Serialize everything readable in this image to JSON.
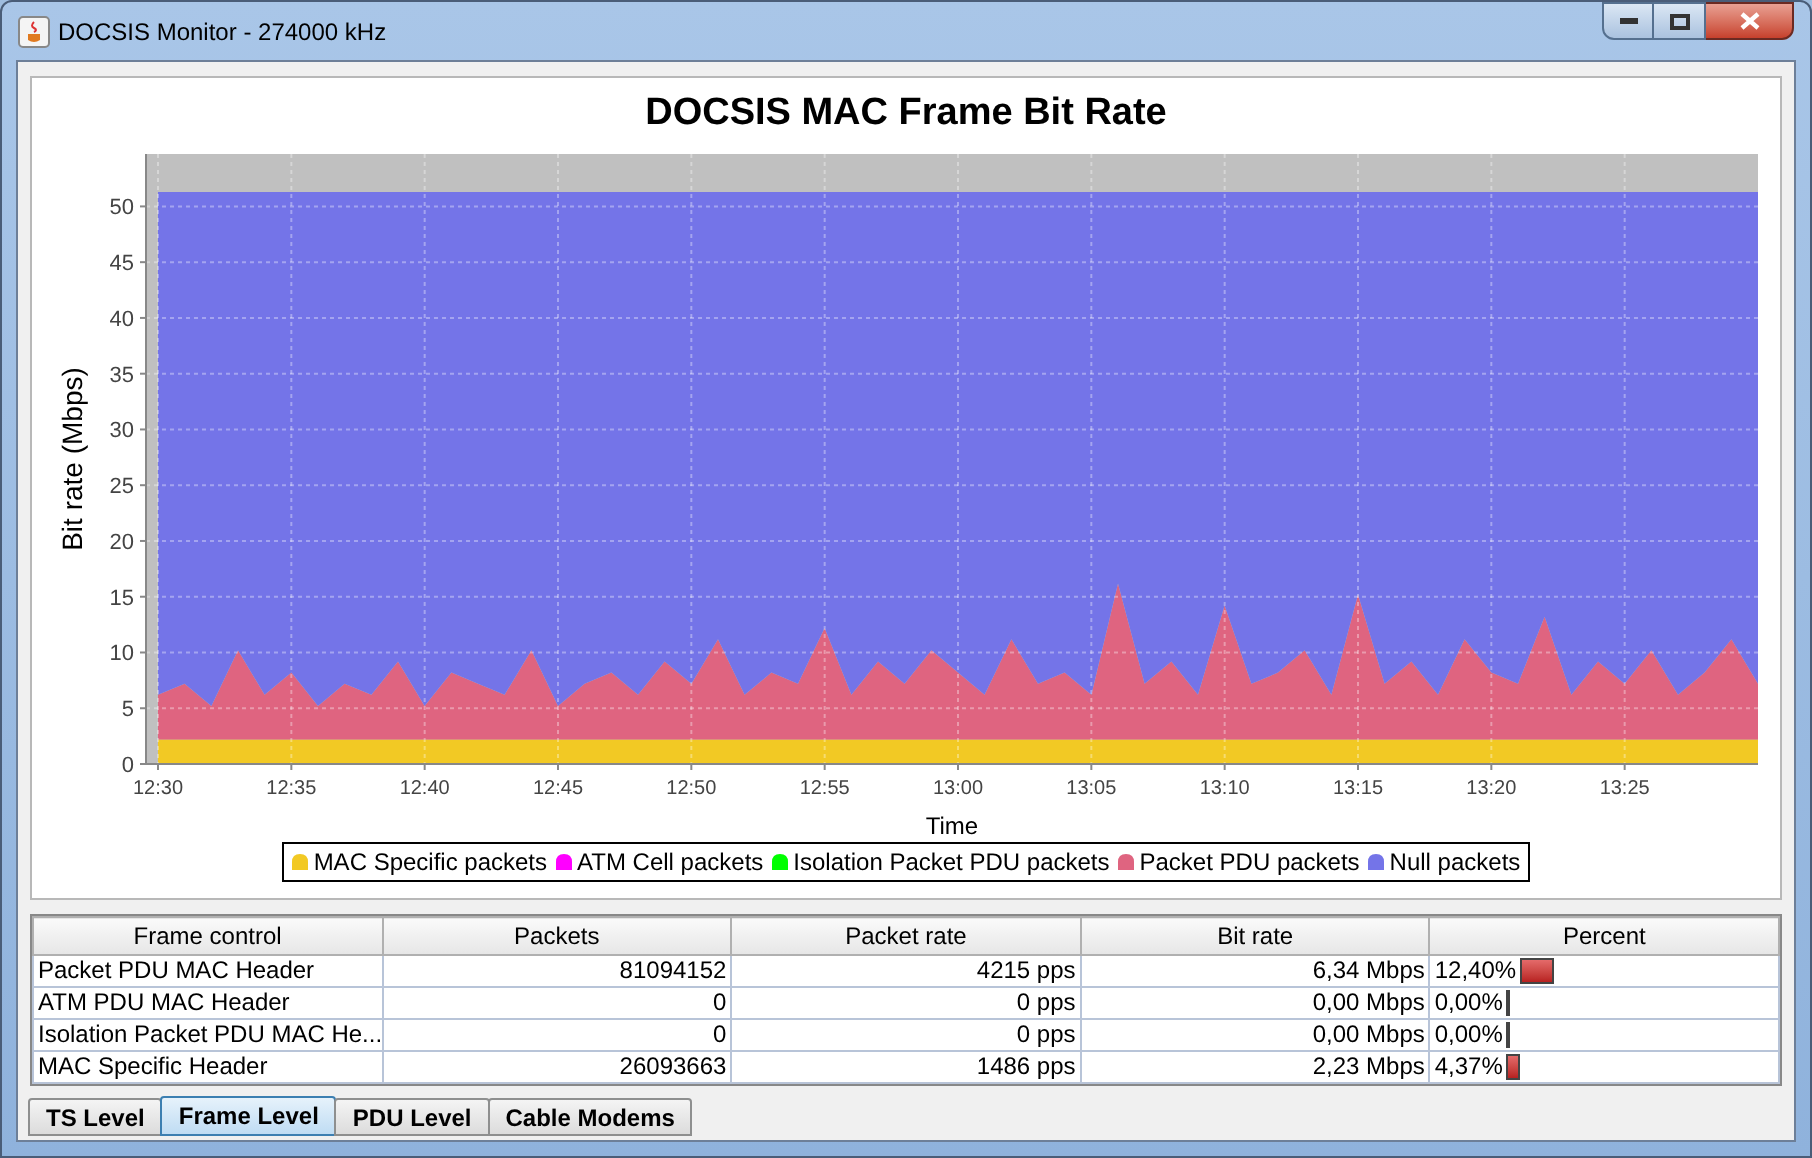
{
  "window": {
    "title": "DOCSIS Monitor - 274000 kHz"
  },
  "chart": {
    "chart_data": {
      "type": "area",
      "stacked": true,
      "grid": true,
      "title": "DOCSIS MAC Frame Bit Rate",
      "xlabel": "Time",
      "ylabel": "Bit rate (Mbps)",
      "categories": [
        "12:30",
        null,
        null,
        null,
        null,
        "12:35",
        null,
        null,
        null,
        null,
        "12:40",
        null,
        null,
        null,
        null,
        "12:45",
        null,
        null,
        null,
        null,
        "12:50",
        null,
        null,
        null,
        null,
        "12:55",
        null,
        null,
        null,
        null,
        "13:00",
        null,
        null,
        null,
        null,
        "13:05",
        null,
        null,
        null,
        null,
        "13:10",
        null,
        null,
        null,
        null,
        "13:15",
        null,
        null,
        null,
        null,
        "13:20",
        null,
        null,
        null,
        null,
        "13:25",
        null,
        null,
        null,
        null,
        null
      ],
      "ylim": [
        0,
        54.7
      ],
      "yticks": [
        0,
        5,
        10,
        15,
        20,
        25,
        30,
        35,
        40,
        45,
        50
      ],
      "series": [
        {
          "color": "#f2c924",
          "values": [
            2.2,
            2.2,
            2.2,
            2.2,
            2.2,
            2.2,
            2.2,
            2.2,
            2.2,
            2.2,
            2.2,
            2.2,
            2.2,
            2.2,
            2.2,
            2.2,
            2.2,
            2.2,
            2.2,
            2.2,
            2.2,
            2.2,
            2.2,
            2.2,
            2.2,
            2.2,
            2.2,
            2.2,
            2.2,
            2.2,
            2.2,
            2.2,
            2.2,
            2.2,
            2.2,
            2.2,
            2.2,
            2.2,
            2.2,
            2.2,
            2.2,
            2.2,
            2.2,
            2.2,
            2.2,
            2.2,
            2.2,
            2.2,
            2.2,
            2.2,
            2.2,
            2.2,
            2.2,
            2.2,
            2.2,
            2.2,
            2.2,
            2.2,
            2.2,
            2.2,
            2.2
          ]
        },
        {
          "color": "#df6480",
          "values": [
            4,
            5,
            3,
            8,
            4,
            6,
            3,
            5,
            4,
            7,
            3,
            6,
            5,
            4,
            8,
            3,
            5,
            6,
            4,
            7,
            5,
            9,
            4,
            6,
            5,
            10,
            4,
            7,
            5,
            8,
            6,
            4,
            9,
            5,
            6,
            4,
            14,
            5,
            7,
            4,
            12,
            5,
            6,
            8,
            4,
            13,
            5,
            7,
            4,
            9,
            6,
            5,
            11,
            4,
            7,
            5,
            8,
            4,
            6,
            9,
            5
          ]
        },
        {
          "color": "#7474e8",
          "values": [
            45.1,
            44.1,
            46.1,
            41.1,
            45.1,
            43.1,
            46.1,
            44.1,
            45.1,
            42.1,
            46.1,
            43.1,
            44.1,
            45.1,
            41.1,
            46.1,
            44.1,
            43.1,
            45.1,
            42.1,
            44.1,
            40.1,
            45.1,
            43.1,
            44.1,
            39.1,
            45.1,
            42.1,
            44.1,
            41.1,
            43.1,
            45.1,
            40.1,
            44.1,
            43.1,
            45.1,
            35.1,
            44.1,
            42.1,
            45.1,
            37.1,
            44.1,
            43.1,
            41.1,
            45.1,
            36.1,
            44.1,
            42.1,
            45.1,
            40.1,
            43.1,
            44.1,
            38.1,
            45.1,
            42.1,
            44.1,
            41.1,
            45.1,
            43.1,
            40.1,
            44.1
          ]
        }
      ]
    },
    "legend": [
      {
        "name": "MAC Specific packets",
        "color": "#f2c924"
      },
      {
        "name": "ATM Cell packets",
        "color": "#ff00ff"
      },
      {
        "name": "Isolation Packet PDU packets",
        "color": "#00ff00"
      },
      {
        "name": "Packet PDU packets",
        "color": "#df6480"
      },
      {
        "name": "Null packets",
        "color": "#7474e8"
      }
    ]
  },
  "table": {
    "columns": [
      "Frame control",
      "Packets",
      "Packet rate",
      "Bit rate",
      "Percent"
    ],
    "rows": [
      {
        "frame_control": "Packet PDU MAC Header",
        "packets": "81094152",
        "packet_rate": "4215 pps",
        "bit_rate": "6,34 Mbps",
        "percent": "12,40%",
        "level": 0.124
      },
      {
        "frame_control": "ATM PDU MAC Header",
        "packets": "0",
        "packet_rate": "0 pps",
        "bit_rate": "0,00 Mbps",
        "percent": "0,00%",
        "level": 0
      },
      {
        "frame_control": "Isolation Packet PDU MAC He...",
        "packets": "0",
        "packet_rate": "0 pps",
        "bit_rate": "0,00 Mbps",
        "percent": "0,00%",
        "level": 0
      },
      {
        "frame_control": "MAC Specific Header",
        "packets": "26093663",
        "packet_rate": "1486 pps",
        "bit_rate": "2,23 Mbps",
        "percent": "4,37%",
        "level": 0.0437
      }
    ]
  },
  "tabs": [
    {
      "label": "TS Level",
      "selected": false
    },
    {
      "label": "Frame Level",
      "selected": true
    },
    {
      "label": "PDU Level",
      "selected": false
    },
    {
      "label": "Cable Modems",
      "selected": false
    }
  ]
}
